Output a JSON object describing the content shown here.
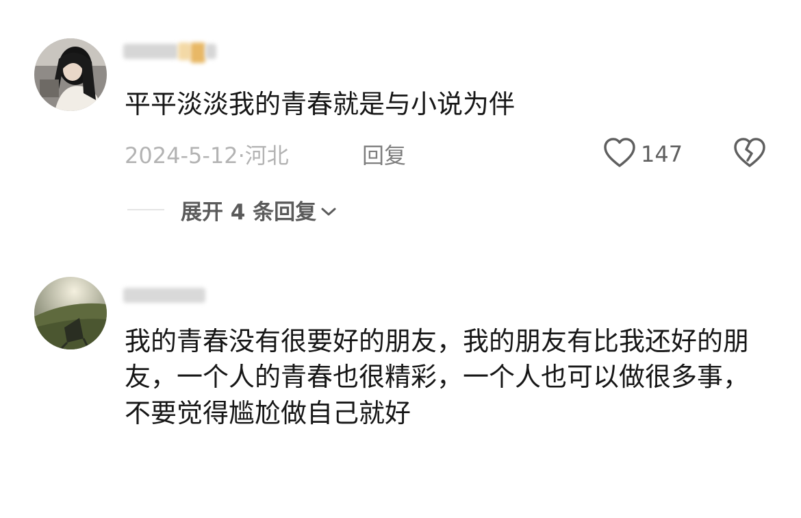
{
  "comments": [
    {
      "text": "平平淡淡我的青春就是与小说为伴",
      "date": "2024-5-12·",
      "location": "河北",
      "reply_label": "回复",
      "like_count": "147",
      "expand_label": "展开 4 条回复"
    },
    {
      "text": "我的青春没有很要好的朋友，我的朋友有比我还好的朋友，一个人的青春也很精彩，一个人也可以做很多事，不要觉得尴尬做自己就好"
    }
  ],
  "icons": {
    "like": "heart-outline-icon",
    "dislike": "broken-heart-icon",
    "expand": "chevron-down-icon"
  },
  "colors": {
    "text": "#161616",
    "meta": "#b3b3b3",
    "icon": "#5f5f5f"
  }
}
